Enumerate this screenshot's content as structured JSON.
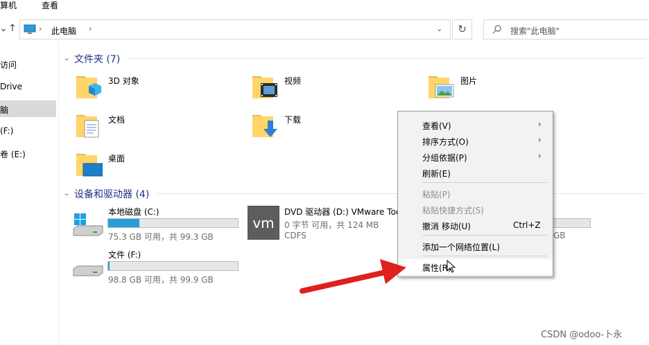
{
  "ribbon": {
    "tab_computer": "计算机",
    "tab_view": "查看"
  },
  "address": {
    "path": "此电脑"
  },
  "search": {
    "placeholder": "搜索\"此电脑\""
  },
  "sidebar": {
    "items": [
      "访问",
      "Drive",
      "脑",
      "(F:)",
      "卷 (E:)"
    ]
  },
  "groups": {
    "folders_title": "文件夹 (7)",
    "drives_title": "设备和驱动器 (4)"
  },
  "folders": [
    "3D 对象",
    "视频",
    "图片",
    "文档",
    "下载",
    "桌面"
  ],
  "drives": [
    {
      "name": "本地磁盘 (C:)",
      "free": "75.3 GB 可用，共 99.3 GB",
      "used_fraction": 0.24
    },
    {
      "name": "DVD 驱动器 (D:) VMware Too",
      "free": "0 字节 可用，共 124 MB",
      "fs": "CDFS"
    },
    {
      "name": "文件 (F:)",
      "free": "98.8 GB 可用，共 99.9 GB",
      "used_fraction": 0.01
    },
    {
      "partial_free": "GB"
    }
  ],
  "menu": {
    "items": [
      {
        "label": "查看(V)",
        "submenu": true
      },
      {
        "label": "排序方式(O)",
        "submenu": true
      },
      {
        "label": "分组依据(P)",
        "submenu": true
      },
      {
        "label": "刷新(E)"
      },
      {
        "label": "粘贴(P)",
        "disabled": true
      },
      {
        "label": "粘贴快捷方式(S)",
        "disabled": true
      },
      {
        "label": "撤消 移动(U)",
        "shortcut": "Ctrl+Z"
      },
      {
        "label": "添加一个网络位置(L)"
      },
      {
        "label": "属性(R)"
      }
    ]
  },
  "watermark": "CSDN @odoo-卜永",
  "colors": {
    "accent": "#26a0da",
    "header": "#1e3287",
    "arrow": "#e0201c"
  }
}
